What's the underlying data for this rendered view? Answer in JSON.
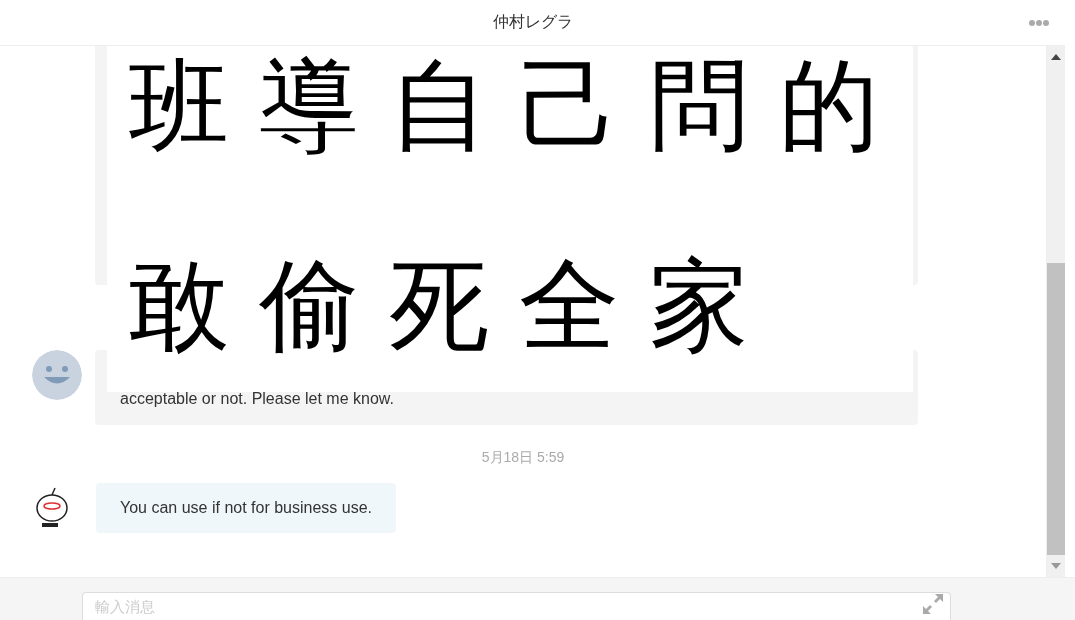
{
  "header": {
    "title": "仲村レグラ"
  },
  "image_message": {
    "lines": [
      "班導自己問的",
      "敢偷死全家"
    ]
  },
  "messages": [
    {
      "kind": "received",
      "text": "acceptable or not. Please let me know."
    },
    {
      "kind": "time",
      "text": "5月18日 5:59"
    },
    {
      "kind": "sent",
      "text": "You can use if not for business use."
    }
  ],
  "composer": {
    "placeholder": "輸入消息"
  }
}
